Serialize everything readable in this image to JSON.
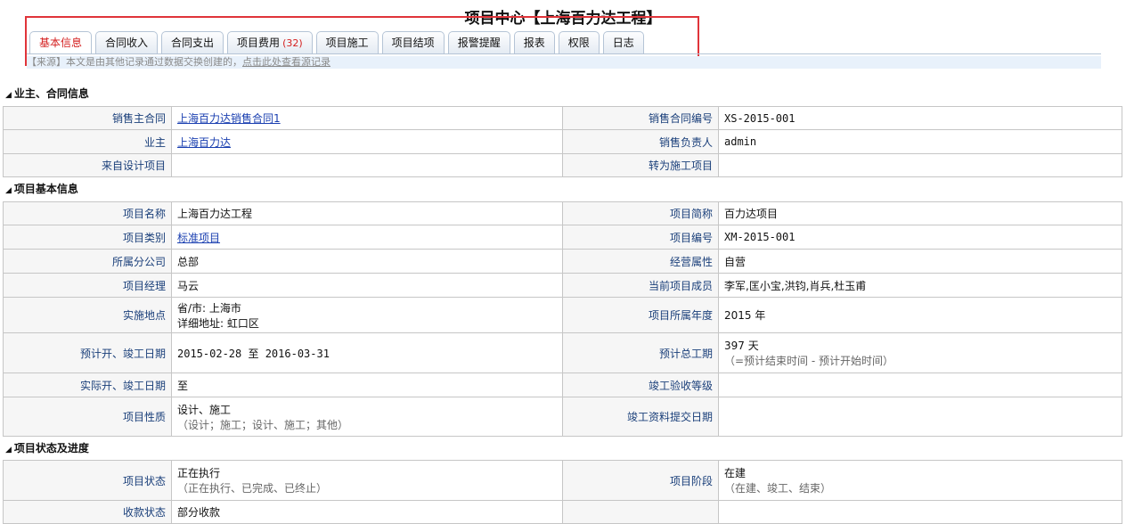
{
  "page_title": "项目中心【上海百力达工程】",
  "tabs": [
    {
      "label": "基本信息",
      "count": ""
    },
    {
      "label": "合同收入",
      "count": ""
    },
    {
      "label": "合同支出",
      "count": ""
    },
    {
      "label": "项目费用",
      "count": "(32)"
    },
    {
      "label": "项目施工",
      "count": ""
    },
    {
      "label": "项目结项",
      "count": ""
    },
    {
      "label": "报警提醒",
      "count": ""
    },
    {
      "label": "报表",
      "count": ""
    },
    {
      "label": "权限",
      "count": ""
    },
    {
      "label": "日志",
      "count": ""
    }
  ],
  "source_notice": {
    "prefix": "【来源】",
    "text": "本文是由其他记录通过数据交换创建的，",
    "link": "点击此处查看源记录"
  },
  "colors": {
    "active_tab": "#d41e1e",
    "highlight_box": "#e0343a",
    "link": "#1a3fb0",
    "label": "#1a3f7a"
  },
  "sections": [
    {
      "title": "业主、合同信息",
      "rows": [
        {
          "l1": "销售主合同",
          "v1": "上海百力达销售合同1",
          "l2": "销售合同编号",
          "v2": "XS-2015-001"
        },
        {
          "l1": "业主",
          "v1": "上海百力达",
          "l2": "销售负责人",
          "v2": "admin"
        },
        {
          "l1": "来自设计项目",
          "v1": "",
          "l2": "转为施工项目",
          "v2": ""
        }
      ]
    },
    {
      "title": "项目基本信息",
      "rows": [
        {
          "l1": "项目名称",
          "v1": "上海百力达工程",
          "l2": "项目简称",
          "v2": "百力达项目"
        },
        {
          "l1": "项目类别",
          "v1": "标准项目",
          "l2": "项目编号",
          "v2": "XM-2015-001"
        },
        {
          "l1": "所属分公司",
          "v1": "总部",
          "l2": "经营属性",
          "v2": "自营"
        },
        {
          "l1": "项目经理",
          "v1": "马云",
          "l2": "当前项目成员",
          "v2": "李军,匡小宝,洪钧,肖兵,杜玉甫"
        },
        {
          "l1": "实施地点",
          "v1a": "省/市: 上海市",
          "v1b": "详细地址: 虹口区",
          "l2": "项目所属年度",
          "v2": "2015 年"
        },
        {
          "l1": "预计开、竣工日期",
          "v1": "2015-02-28 至 2016-03-31",
          "l2": "预计总工期",
          "v2a": "397 天",
          "v2b": "（=预计结束时间 - 预计开始时间）"
        },
        {
          "l1": "实际开、竣工日期",
          "v1": "至",
          "l2": "竣工验收等级",
          "v2": ""
        },
        {
          "l1": "项目性质",
          "v1a": "设计、施工",
          "v1b": "（设计；施工；设计、施工；其他）",
          "l2": "竣工资料提交日期",
          "v2": ""
        }
      ]
    },
    {
      "title": "项目状态及进度",
      "rows": [
        {
          "l1": "项目状态",
          "v1a": "正在执行",
          "v1b": "（正在执行、已完成、已终止）",
          "l2": "项目阶段",
          "v2a": "在建",
          "v2b": "（在建、竣工、结束）"
        },
        {
          "l1": "收款状态",
          "v1": "部分收款",
          "l2": "",
          "v2": ""
        }
      ]
    }
  ]
}
